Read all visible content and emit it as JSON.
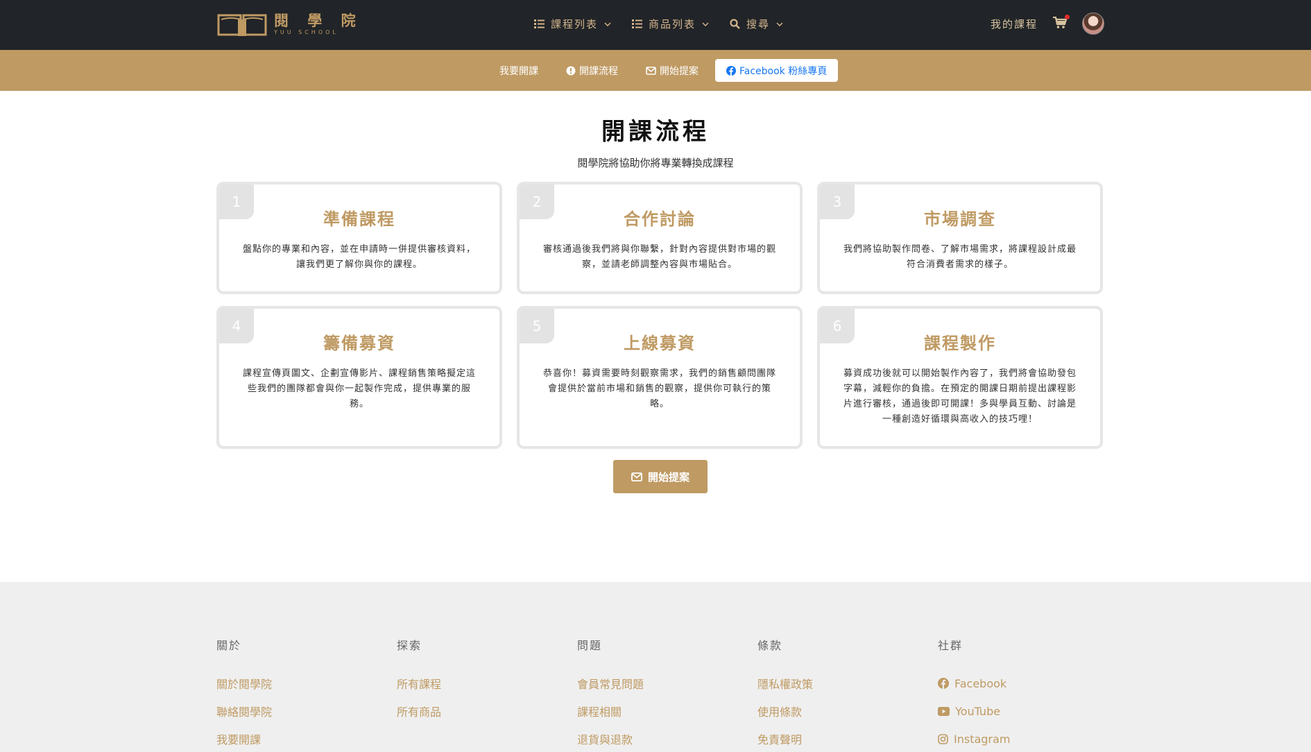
{
  "brand": {
    "name_cn": "閱 學 院",
    "name_en": "YUU SCHOOL",
    "color": "#bf9a63"
  },
  "topnav": {
    "items": [
      {
        "label": "課程列表",
        "icon": "list-icon"
      },
      {
        "label": "商品列表",
        "icon": "list-icon"
      },
      {
        "label": "搜尋",
        "icon": "search-icon"
      }
    ],
    "my_courses": "我的課程",
    "cart_icon": "cart-icon"
  },
  "subnav": {
    "items": [
      {
        "label": "我要開課"
      },
      {
        "label": "開課流程",
        "icon": "info-icon"
      },
      {
        "label": "開始提案",
        "icon": "envelope-icon"
      },
      {
        "label": "Facebook 粉絲專頁",
        "icon": "facebook-icon"
      }
    ]
  },
  "main": {
    "title": "開課流程",
    "subtitle": "閱學院將協助你將專業轉換成課程",
    "steps": [
      {
        "num": "1",
        "title": "準備課程",
        "text": "盤點你的專業和內容，並在申請時一併提供審核資料，讓我們更了解你與你的課程。"
      },
      {
        "num": "2",
        "title": "合作討論",
        "text": "審核通過後我們將與你聯繫，針對內容提供對市場的觀察，並請老師調整內容與市場貼合。"
      },
      {
        "num": "3",
        "title": "市場調查",
        "text": "我們將協助製作問卷、了解市場需求，將課程設計成最符合消費者需求的樣子。"
      },
      {
        "num": "4",
        "title": "籌備募資",
        "text": "課程宣傳頁圖文、企劃宣傳影片、課程銷售策略擬定這些我們的團隊都會與你一起製作完成，提供專業的服務。"
      },
      {
        "num": "5",
        "title": "上線募資",
        "text": "恭喜你！募資需要時刻觀察需求，我們的銷售顧問團隊會提供於當前市場和銷售的觀察，提供你可執行的策略。"
      },
      {
        "num": "6",
        "title": "課程製作",
        "text": "募資成功後就可以開始製作內容了，我們將會協助發包字幕，減輕你的負擔。在預定的開課日期前提出課程影片進行審核，通過後即可開課！多與學員互動、討論是一種創造好循環與高收入的技巧哩！"
      }
    ],
    "cta_label": "開始提案"
  },
  "footer": {
    "columns": [
      {
        "heading": "關於",
        "links": [
          "關於閱學院",
          "聯絡閱學院",
          "我要開課"
        ]
      },
      {
        "heading": "探索",
        "links": [
          "所有課程",
          "所有商品"
        ]
      },
      {
        "heading": "問題",
        "links": [
          "會員常見問題",
          "課程相關",
          "退貨與退款"
        ]
      },
      {
        "heading": "條款",
        "links": [
          "隱私權政策",
          "使用條款",
          "免責聲明"
        ]
      },
      {
        "heading": "社群",
        "links": [
          "Facebook",
          "YouTube",
          "Instagram"
        ]
      }
    ]
  }
}
